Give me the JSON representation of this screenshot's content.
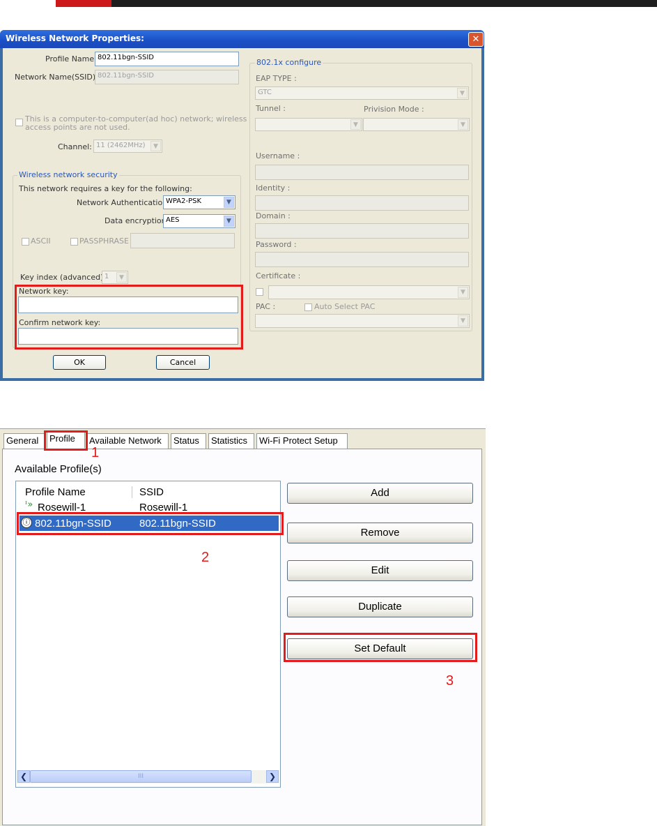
{
  "dialog": {
    "title": "Wireless Network Properties:",
    "close_symbol": "✕",
    "profile_name_label": "Profile Name:",
    "profile_name_value": "802.11bgn-SSID",
    "ssid_label": "Network Name(SSID):",
    "ssid_value": "802.11bgn-SSID",
    "adhoc_text_1": "This is a computer-to-computer(ad hoc) network; wireless",
    "adhoc_text_2": "access points are not used.",
    "channel_label": "Channel:",
    "channel_value": "11 (2462MHz)",
    "security_group_title": "Wireless network security",
    "security_intro": "This network requires a key for the following:",
    "auth_label": "Network Authentication:",
    "auth_value": "WPA2-PSK",
    "encryption_label": "Data encryption:",
    "encryption_value": "AES",
    "ascii_label": "ASCII",
    "passphrase_label": "PASSPHRASE",
    "key_index_label": "Key index (advanced):",
    "key_index_value": "1",
    "network_key_label": "Network key:",
    "confirm_key_label": "Confirm network key:",
    "ok_label": "OK",
    "cancel_label": "Cancel",
    "dot1x": {
      "group_title": "802.1x configure",
      "eap_type_label": "EAP TYPE :",
      "eap_type_value": "GTC",
      "tunnel_label": "Tunnel :",
      "provision_label": "Privision Mode :",
      "username_label": "Username :",
      "identity_label": "Identity :",
      "domain_label": "Domain :",
      "password_label": "Password :",
      "certificate_label": "Certificate :",
      "pac_label": "PAC :",
      "auto_pac_label": "Auto Select PAC"
    }
  },
  "utility": {
    "tabs": [
      "General",
      "Profile",
      "Available Network",
      "Status",
      "Statistics",
      "Wi-Fi Protect Setup"
    ],
    "available_profiles_label": "Available Profile(s)",
    "columns": [
      "Profile Name",
      "SSID"
    ],
    "profiles": [
      {
        "name": "Rosewill-1",
        "ssid": "Rosewill-1"
      },
      {
        "name": "802.11bgn-SSID",
        "ssid": "802.11bgn-SSID"
      }
    ],
    "buttons": {
      "add": "Add",
      "remove": "Remove",
      "edit": "Edit",
      "duplicate": "Duplicate",
      "set_default": "Set Default"
    },
    "scroll_grip": "III",
    "step_numbers": [
      "1",
      "2",
      "3"
    ]
  },
  "colors": {
    "annotation_red": "#e21b1b",
    "title_bar_blue": "#1b4fc7",
    "selection_blue": "#316ac5",
    "header_red": "#cc1a1a"
  }
}
